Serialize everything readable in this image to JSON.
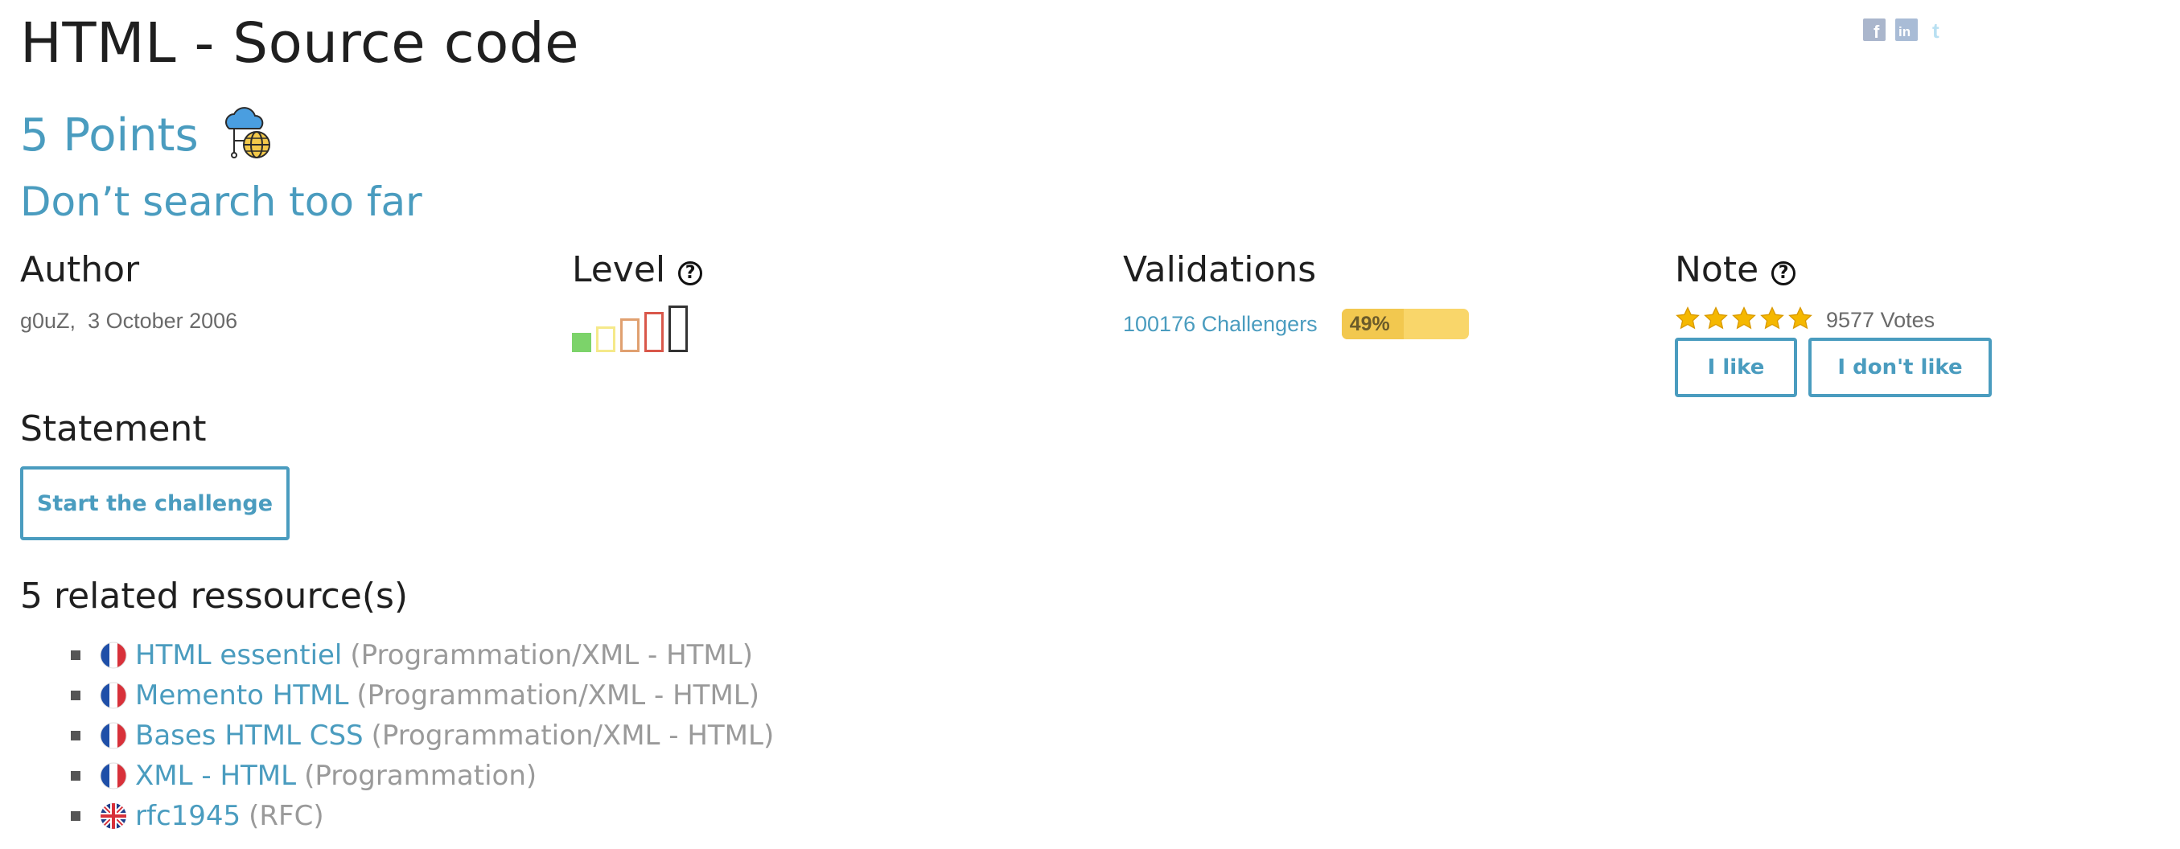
{
  "page": {
    "title": "HTML - Source code",
    "points": "5 Points",
    "subtitle": "Don’t search too far"
  },
  "social": {
    "icons": [
      "facebook-icon",
      "linkedin-icon",
      "twitter-icon"
    ]
  },
  "author": {
    "heading": "Author",
    "name": "g0uZ,",
    "date": "3 October 2006"
  },
  "level": {
    "heading": "Level",
    "current": 1,
    "max": 5
  },
  "validations": {
    "heading": "Validations",
    "challengers": "100176 Challengers",
    "percent_label": "49%",
    "percent": 49
  },
  "note": {
    "heading": "Note",
    "stars": 5,
    "votes": "9577 Votes",
    "like_label": "I like",
    "dislike_label": "I don't like"
  },
  "statement": {
    "heading": "Statement",
    "start_label": "Start the challenge"
  },
  "resources": {
    "heading": "5 related ressource(s)",
    "items": [
      {
        "lang": "fr",
        "title": "HTML essentiel",
        "category": "(Programmation/XML - HTML)"
      },
      {
        "lang": "fr",
        "title": "Memento HTML",
        "category": "(Programmation/XML - HTML)"
      },
      {
        "lang": "fr",
        "title": "Bases HTML CSS",
        "category": "(Programmation/XML - HTML)"
      },
      {
        "lang": "fr",
        "title": "XML - HTML",
        "category": "(Programmation)"
      },
      {
        "lang": "en",
        "title": "rfc1945",
        "category": "(RFC)"
      }
    ]
  },
  "colors": {
    "accent": "#4a9cbf",
    "progress": "#f9d66a",
    "star": "#f5b800"
  }
}
